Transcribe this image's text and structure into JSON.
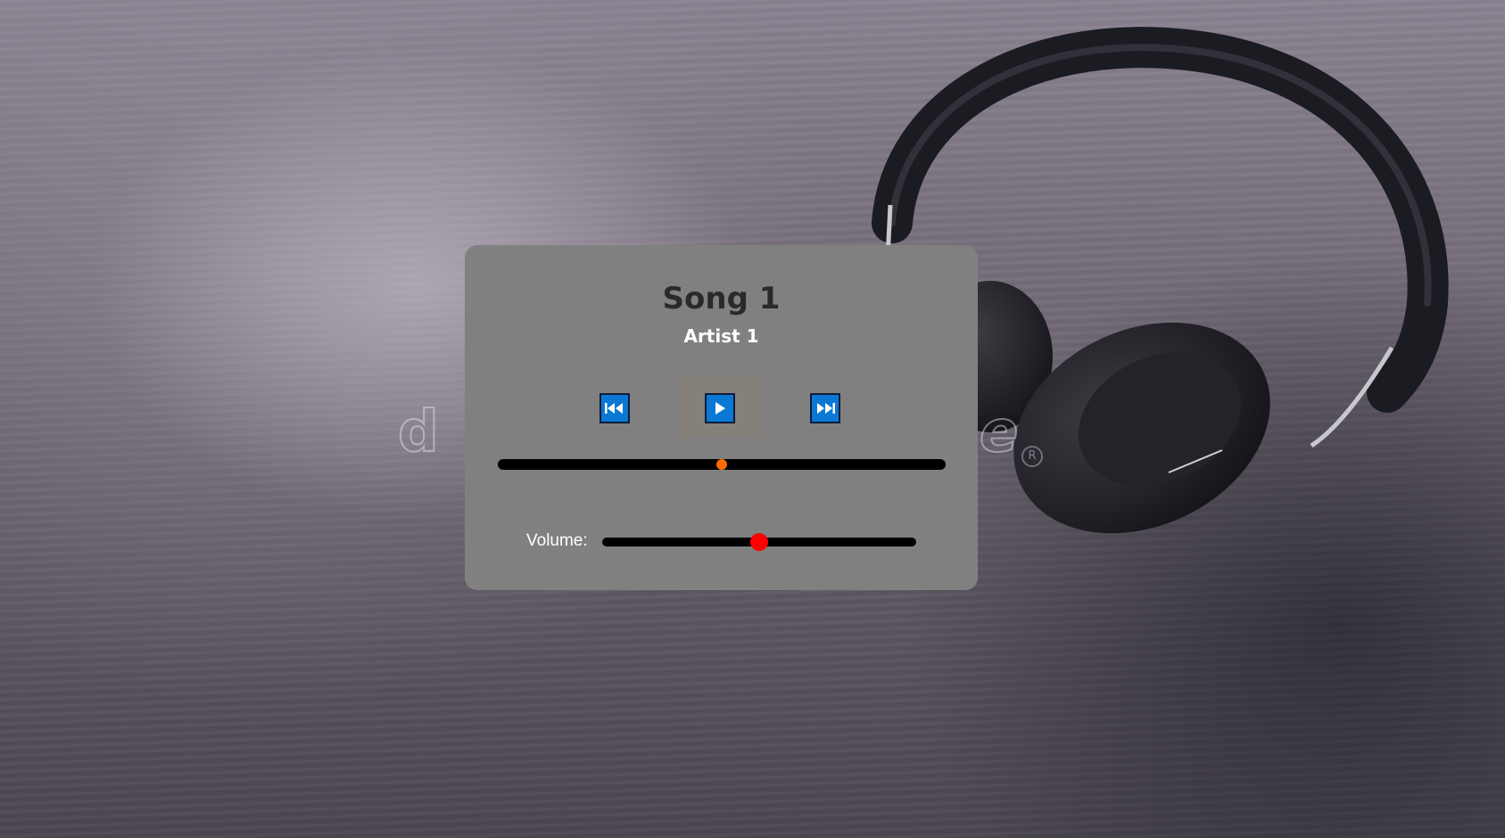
{
  "song": {
    "title": "Song 1",
    "artist": "Artist 1"
  },
  "controls": {
    "prev_icon": "skip-previous-icon",
    "play_icon": "play-icon",
    "next_icon": "skip-next-icon"
  },
  "progress": {
    "fraction": 0.5,
    "thumb_color": "#ff6a00"
  },
  "volume": {
    "label": "Volume:",
    "fraction": 0.5,
    "thumb_color": "#ff0000"
  },
  "colors": {
    "player_background": "#808080",
    "button_accent": "#0a78d4"
  },
  "background": {
    "image_subject": "headphones on dark wooden surface",
    "watermark": "d e ®"
  }
}
